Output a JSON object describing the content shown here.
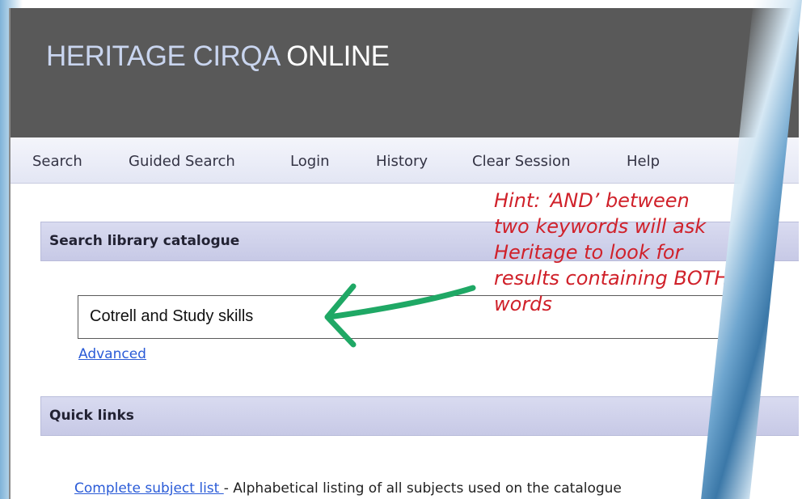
{
  "header": {
    "title_part1": "HERITAGE CIRQA ",
    "title_part2": "ONLINE"
  },
  "nav": {
    "items": [
      {
        "label": "Search"
      },
      {
        "label": "Guided Search"
      },
      {
        "label": "Login"
      },
      {
        "label": "History"
      },
      {
        "label": "Clear Session"
      },
      {
        "label": "Help"
      }
    ]
  },
  "search_section": {
    "title": "Search library catalogue",
    "query": "Cotrell and Study skills",
    "advanced_label": "Advanced",
    "button_icon": "magnifier-icon"
  },
  "quick_links": {
    "title": "Quick links",
    "subject_link_label": "Complete subject list ",
    "subject_description": "- Alphabetical listing of all subjects used on the catalogue"
  },
  "hint": {
    "lines": [
      "Hint: ‘AND’ between",
      "two keywords will ask",
      "Heritage to look for",
      "results containing BOTH",
      "words"
    ],
    "color": "#d0212a"
  },
  "colors": {
    "header_bg": "#595959",
    "link": "#2a5bd7",
    "arrow": "#1fa865"
  }
}
